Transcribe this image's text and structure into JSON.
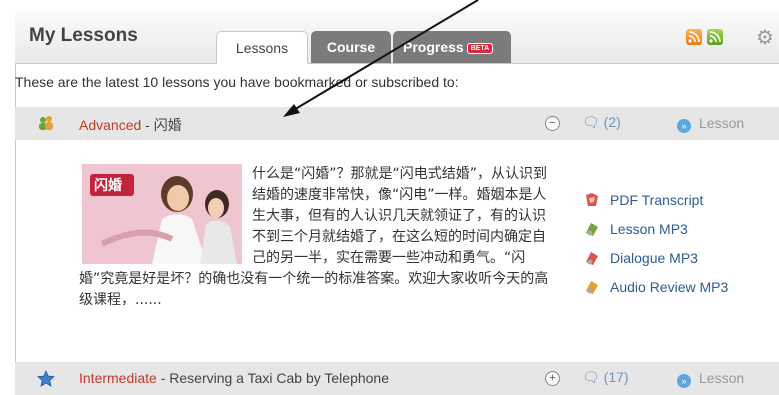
{
  "header": {
    "title": "My Lessons",
    "tabs": [
      {
        "label": "Lessons",
        "active": true
      },
      {
        "label": "Course",
        "active": false
      },
      {
        "label": "Progress",
        "badge": "BETA",
        "active": false
      }
    ],
    "icons": [
      "rss-icon",
      "rss-icon",
      "gear-icon"
    ]
  },
  "intro_text": "These are the latest 10 lessons you have bookmarked or subscribed to:",
  "lessons": [
    {
      "level": "Advanced",
      "title": " - 闪婚",
      "comments": "(2)",
      "link_label": "Lesson",
      "toggle": "−",
      "image_caption": "闪婚",
      "description": "什么是“闪婚”？那就是“闪电式结婚”，从认识到结婚的速度非常快，像“闪电”一样。婚姻本是人生大事，但有的人认识几天就领证了，有的认识不到三个月就结婚了，在这么短的时间内确定自己的另一半，实在需要一些冲动和勇气。“闪婚”究竟是好是坏？的确也没有一个统一的标准答案。欢迎大家收听今天的高级课程，......",
      "resources": [
        "PDF Transcript",
        "Lesson MP3",
        "Dialogue MP3",
        "Audio Review MP3"
      ]
    },
    {
      "level": "Intermediate",
      "title": " - Reserving a Taxi Cab by Telephone",
      "comments": "(17)",
      "link_label": "Lesson",
      "toggle": "+"
    }
  ],
  "colors": {
    "level": "#c0392b",
    "link": "#2d5c96",
    "tab_inactive": "#7b7b7b",
    "beta": "#d8293d"
  }
}
